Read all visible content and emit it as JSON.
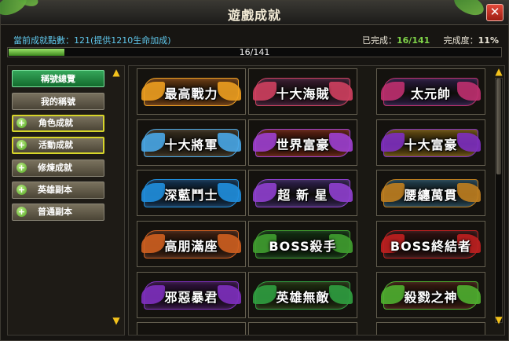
{
  "window": {
    "title": "遊戲成就",
    "close_label": "✕"
  },
  "stats": {
    "points_text": "當前成就點數：121(提供1210生命加成)",
    "completed_label": "已完成：",
    "completed_value": "16/141",
    "rate_label": "完成度：",
    "rate_value": "11%"
  },
  "progress": {
    "text": "16/141",
    "value": 0.113
  },
  "sidebar": {
    "main_tabs": [
      {
        "label": "稱號總覽",
        "active": true
      },
      {
        "label": "我的稱號",
        "active": false
      }
    ],
    "categories": [
      {
        "label": "角色成就",
        "highlight": true
      },
      {
        "label": "活動成就",
        "highlight": true
      },
      {
        "label": "修煉成就",
        "highlight": false
      },
      {
        "label": "英雄副本",
        "highlight": false
      },
      {
        "label": "普通副本",
        "highlight": false
      }
    ],
    "scroll_up": "▲",
    "scroll_down": "▼"
  },
  "titles": [
    {
      "text": "最高戰力",
      "color": "#f0a020",
      "accent": "#6a3a10"
    },
    {
      "text": "十大海賊",
      "color": "#d04060",
      "accent": "#3a1a30"
    },
    {
      "text": "太元帥",
      "color": "#c03070",
      "accent": "#2a1a40"
    },
    {
      "text": "十大將軍",
      "color": "#4aa8e8",
      "accent": "#3a3020"
    },
    {
      "text": "世界富豪",
      "color": "#a040d0",
      "accent": "#602010"
    },
    {
      "text": "十大富豪",
      "color": "#8030c0",
      "accent": "#6a5010"
    },
    {
      "text": "深藍鬥士",
      "color": "#2090e0",
      "accent": "#103050"
    },
    {
      "text": "超 新 星",
      "color": "#9040d0",
      "accent": "#302050"
    },
    {
      "text": "腰纏萬貫",
      "color": "#c08020",
      "accent": "#204050"
    },
    {
      "text": "高朋滿座",
      "color": "#d06020",
      "accent": "#402010"
    },
    {
      "text": "BOSS殺手",
      "color": "#40a030",
      "accent": "#103010"
    },
    {
      "text": "BOSS終結者",
      "color": "#c02020",
      "accent": "#301010"
    },
    {
      "text": "邪惡暴君",
      "color": "#8030c0",
      "accent": "#301040"
    },
    {
      "text": "英雄無敵",
      "color": "#30a040",
      "accent": "#203010"
    },
    {
      "text": "殺戮之神",
      "color": "#50b030",
      "accent": "#3a1a10"
    }
  ],
  "grid_scroll": {
    "up": "▲",
    "down": "▼",
    "position": 0
  },
  "colors": {
    "accent_green": "#7fd349",
    "info_blue": "#5fc6ea",
    "arrow_gold": "#f3c21c"
  }
}
